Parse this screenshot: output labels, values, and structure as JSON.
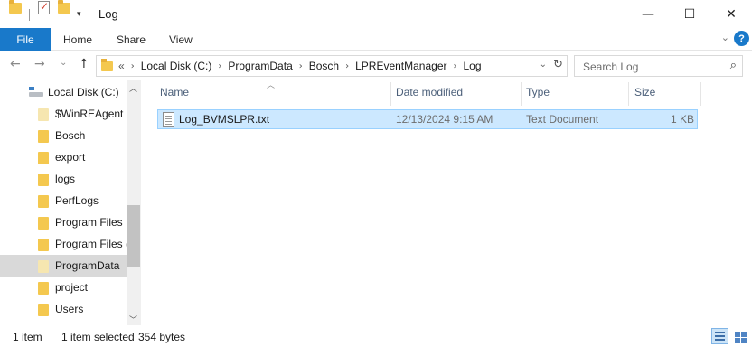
{
  "window": {
    "title": "Log",
    "controls": {
      "minimize": "—",
      "maximize": "☐",
      "close": "✕"
    }
  },
  "ribbon": {
    "tabs": [
      "File",
      "Home",
      "Share",
      "View"
    ],
    "help_label": "?"
  },
  "nav": {
    "back": "←",
    "forward": "→",
    "recent": "⌄",
    "up": "↑"
  },
  "address": {
    "overflow": "«",
    "crumbs": [
      "Local Disk (C:)",
      "ProgramData",
      "Bosch",
      "LPREventManager",
      "Log"
    ]
  },
  "search": {
    "placeholder": "Search Log"
  },
  "tree": {
    "root": "Local Disk (C:)",
    "items": [
      {
        "label": "$WinREAgent",
        "pale": true
      },
      {
        "label": "Bosch"
      },
      {
        "label": "export"
      },
      {
        "label": "logs"
      },
      {
        "label": "PerfLogs"
      },
      {
        "label": "Program Files"
      },
      {
        "label": "Program Files ("
      },
      {
        "label": "ProgramData",
        "selected": true,
        "pale": true
      },
      {
        "label": "project"
      },
      {
        "label": "Users"
      }
    ]
  },
  "columns": {
    "name": "Name",
    "date": "Date modified",
    "type": "Type",
    "size": "Size"
  },
  "files": [
    {
      "name": "Log_BVMSLPR.txt",
      "date": "12/13/2024 9:15 AM",
      "type": "Text Document",
      "size": "1 KB",
      "selected": true
    }
  ],
  "status": {
    "count": "1 item",
    "selected": "1 item selected",
    "bytes": "354 bytes"
  },
  "colors": {
    "accent": "#1979ca",
    "selection_fill": "#cce8ff",
    "selection_border": "#99d1ff",
    "folder": "#f4c84f"
  }
}
